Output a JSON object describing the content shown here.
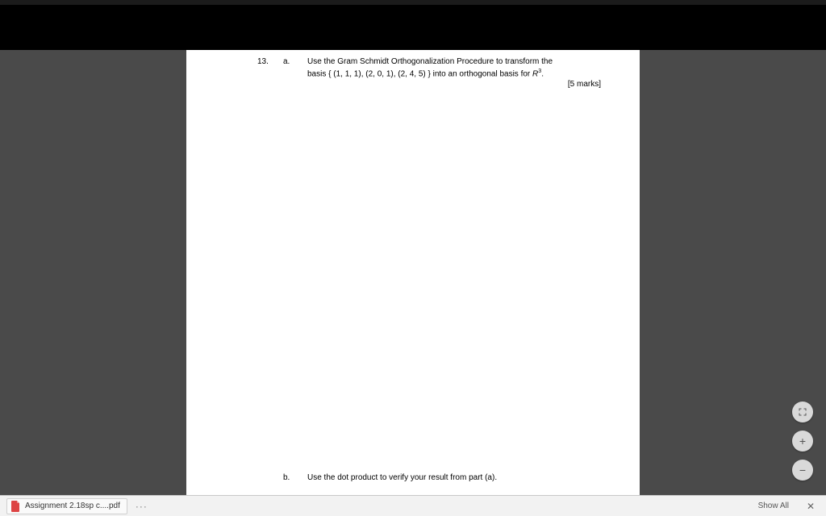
{
  "document": {
    "question_number": "13.",
    "parts": {
      "a": {
        "label": "a.",
        "line1": "Use the Gram Schmidt Orthogonalization Procedure to transform the",
        "line2_prefix": "basis { (1, 1, 1), (2, 0, 1), (2, 4, 5) } into an orthogonal basis for ",
        "line2_space_sym": "R",
        "line2_space_exp": "3",
        "line2_suffix": ".",
        "marks": "[5 marks]"
      },
      "b": {
        "label": "b.",
        "text": "Use the dot product to verify your result from part (a)."
      }
    }
  },
  "viewer_controls": {
    "fit": "Fit to page",
    "zoom_in": "+",
    "zoom_out": "−"
  },
  "download_bar": {
    "filename": "Assignment 2.18sp c....pdf",
    "more": "···",
    "show_all": "Show All",
    "close": "✕"
  }
}
